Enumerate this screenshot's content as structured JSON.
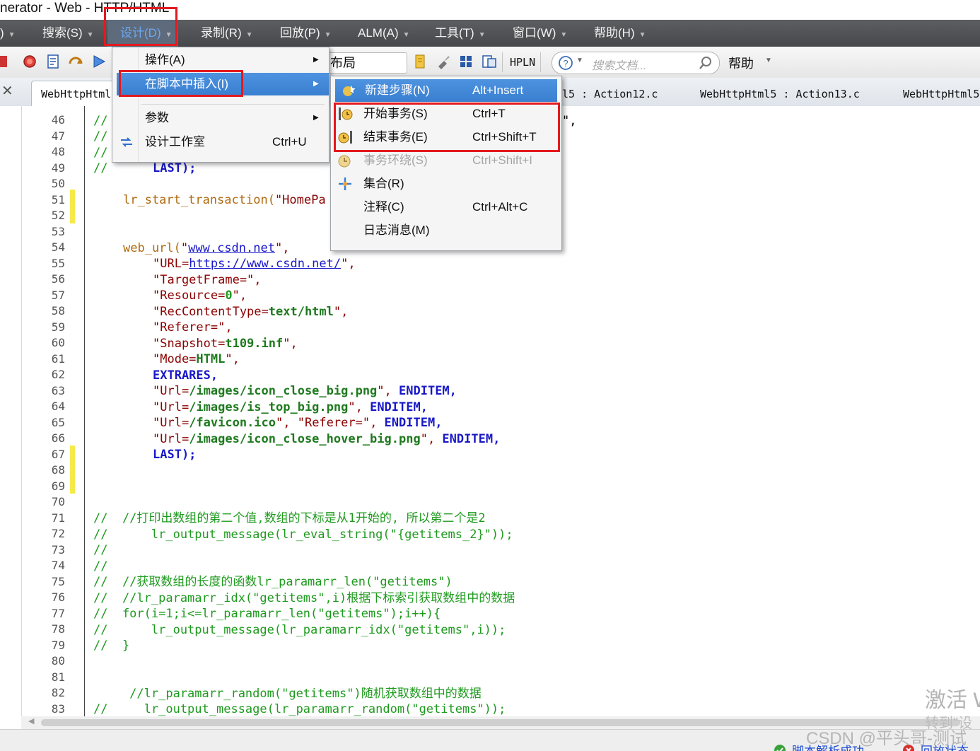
{
  "window": {
    "title": "nerator - Web - HTTP/HTML"
  },
  "menubar": {
    "items": [
      {
        "label": ")"
      },
      {
        "label": "搜索(S)"
      },
      {
        "label": "设计(D)"
      },
      {
        "label": "录制(R)"
      },
      {
        "label": "回放(P)"
      },
      {
        "label": "ALM(A)"
      },
      {
        "label": "工具(T)"
      },
      {
        "label": "窗口(W)"
      },
      {
        "label": "帮助(H)"
      }
    ]
  },
  "toolbar": {
    "layout_combo": "布局",
    "hpln_label": "HPLN",
    "search_placeholder": "搜索文档...",
    "help_label": "帮助"
  },
  "tabs": {
    "active": "WebHttpHtml",
    "others": [
      "l5 : Action12.c",
      "WebHttpHtml5 : Action13.c",
      "WebHttpHtml5"
    ]
  },
  "design_menu": {
    "items": [
      {
        "label": "操作(A)",
        "shortcut": "",
        "submenu": true
      },
      {
        "label": "在脚本中插入(I)",
        "shortcut": "",
        "submenu": true
      },
      {
        "label": "参数",
        "shortcut": "",
        "submenu": true
      },
      {
        "label": "设计工作室",
        "shortcut": "Ctrl+U",
        "submenu": false
      }
    ]
  },
  "insert_submenu": {
    "items": [
      {
        "label": "新建步骤(N)",
        "shortcut": "Alt+Insert"
      },
      {
        "label": "开始事务(S)",
        "shortcut": "Ctrl+T"
      },
      {
        "label": "结束事务(E)",
        "shortcut": "Ctrl+Shift+T"
      },
      {
        "label": "事务环绕(S)",
        "shortcut": "Ctrl+Shift+I"
      },
      {
        "label": "集合(R)",
        "shortcut": ""
      },
      {
        "label": "注释(C)",
        "shortcut": "Ctrl+Alt+C"
      },
      {
        "label": "日志消息(M)",
        "shortcut": ""
      }
    ]
  },
  "editor": {
    "line_numbers": [
      46,
      47,
      48,
      49,
      50,
      51,
      52,
      53,
      54,
      55,
      56,
      57,
      58,
      59,
      60,
      61,
      62,
      63,
      64,
      65,
      66,
      67,
      68,
      69,
      70,
      71,
      72,
      73,
      74,
      75,
      76,
      77,
      78,
      79,
      80,
      81,
      82,
      83
    ],
    "code": {
      "l46": "//",
      "l47": "//",
      "l48": "//",
      "l49_comment": "//",
      "l49_code": "LAST);",
      "l51_fn": "lr_start_transaction(",
      "l51_str": "\"HomePa",
      "l46_tail": "\",",
      "l54_fn": "web_url(",
      "l54_q1": "\"",
      "l54_link": "www.csdn.net",
      "l54_q2": "\",",
      "l55_a": "\"URL=",
      "l55_link": "https://www.csdn.net/",
      "l55_b": "\",",
      "l56": "\"TargetFrame=\",",
      "l57_a": "\"Resource=",
      "l57_b": "0",
      "l57_c": "\",",
      "l58_a": "\"RecContentType=",
      "l58_b": "text/html",
      "l58_c": "\",",
      "l59": "\"Referer=\",",
      "l60_a": "\"Snapshot=",
      "l60_b": "t109.inf",
      "l60_c": "\",",
      "l61_a": "\"Mode=",
      "l61_b": "HTML",
      "l61_c": "\",",
      "l62": "EXTRARES,",
      "l63_a": "\"Url=",
      "l63_b": "/images/icon_close_big.png",
      "l63_c": "\", ",
      "l63_d": "ENDITEM,",
      "l64_a": "\"Url=",
      "l64_b": "/images/is_top_big.png",
      "l64_c": "\", ",
      "l64_d": "ENDITEM,",
      "l65_a": "\"Url=",
      "l65_b": "/favicon.ico",
      "l65_c": "\", \"Referer=\", ",
      "l65_d": "ENDITEM,",
      "l66_a": "\"Url=",
      "l66_b": "/images/icon_close_hover_big.png",
      "l66_c": "\", ",
      "l66_d": "ENDITEM,",
      "l67": "LAST);",
      "l71": "//  //打印出数组的第二个值,数组的下标是从1开始的, 所以第二个是2",
      "l72": "//      lr_output_message(lr_eval_string(\"{getitems_2}\"));",
      "l73": "//",
      "l74": "//",
      "l75": "//  //获取数组的长度的函数lr_paramarr_len(\"getitems\")",
      "l76": "//  //lr_paramarr_idx(\"getitems\",i)根据下标索引获取数组中的数据",
      "l77": "//  for(i=1;i<=lr_paramarr_len(\"getitems\");i++){",
      "l78": "//      lr_output_message(lr_paramarr_idx(\"getitems\",i));",
      "l79": "//  }",
      "l82": "     //lr_paramarr_random(\"getitems\")随机获取数组中的数据",
      "l83": "//     lr_output_message(lr_paramarr_random(\"getitems\"));"
    }
  },
  "status": {
    "left": "脚本解析成功",
    "right": "回放状态"
  },
  "watermark": {
    "activate": "激活 W",
    "goto": "转到\"设",
    "csdn": "CSDN @平头哥-测试"
  }
}
